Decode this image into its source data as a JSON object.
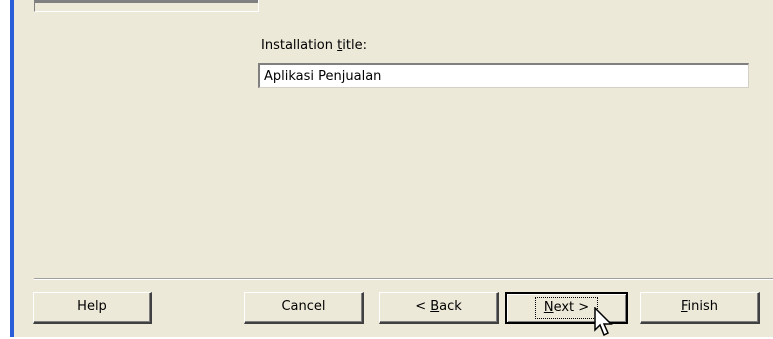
{
  "form": {
    "title_label_before": "Installation ",
    "title_label_accel": "t",
    "title_label_after": "itle:",
    "title_value": "Aplikasi Penjualan"
  },
  "buttons": {
    "help": "Help",
    "cancel": "Cancel",
    "back_before": "< ",
    "back_accel": "B",
    "back_after": "ack",
    "next_accel": "N",
    "next_after": "ext >",
    "finish_accel": "F",
    "finish_after": "inish"
  },
  "colors": {
    "dialog_bg": "#ece9d8",
    "window_frame": "#2a5ed9"
  },
  "icons": [
    "mouse-pointer-icon"
  ]
}
